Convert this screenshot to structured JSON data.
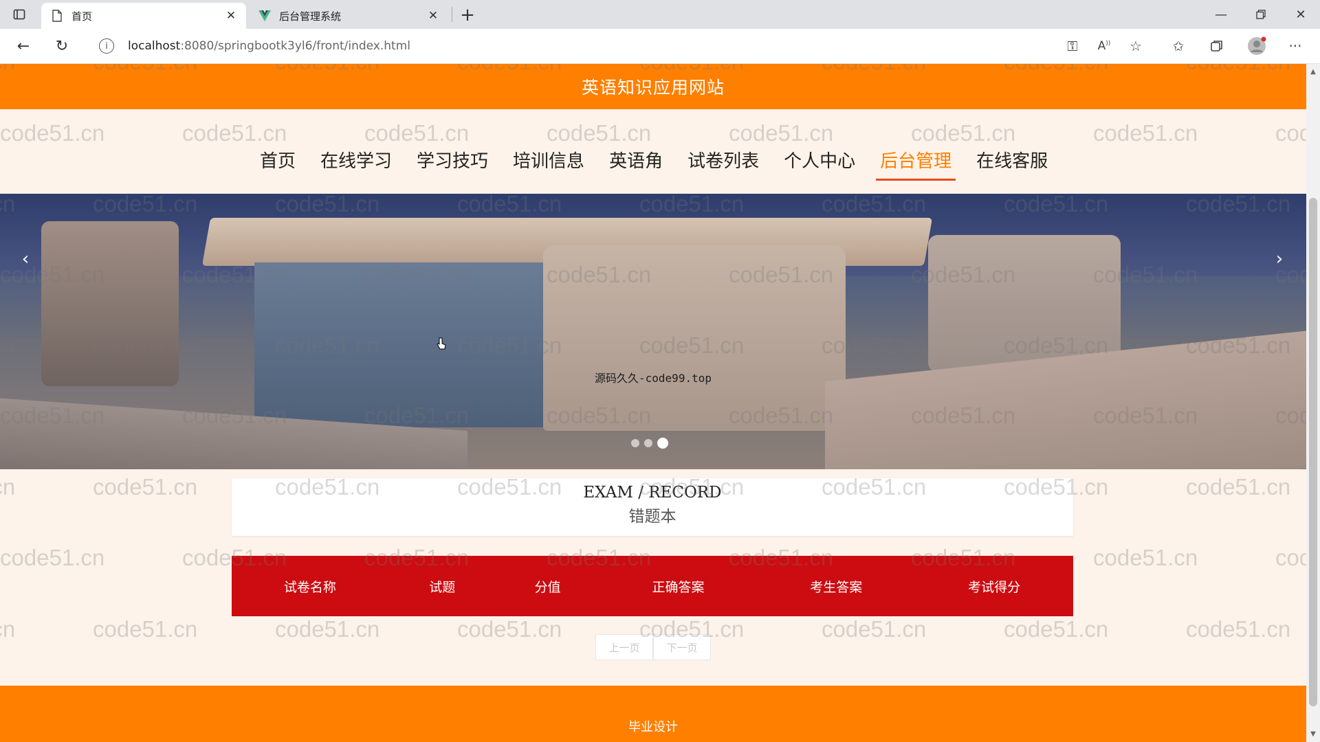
{
  "browser": {
    "tabs": [
      {
        "title": "首页",
        "active": true
      },
      {
        "title": "后台管理系统",
        "active": false
      }
    ],
    "address": {
      "host": "localhost",
      "path": ":8080/springbootk3yl6/front/index.html"
    }
  },
  "site": {
    "title": "英语知识应用网站",
    "nav": [
      {
        "label": "首页",
        "active": false
      },
      {
        "label": "在线学习",
        "active": false
      },
      {
        "label": "学习技巧",
        "active": false
      },
      {
        "label": "培训信息",
        "active": false
      },
      {
        "label": "英语角",
        "active": false
      },
      {
        "label": "试卷列表",
        "active": false
      },
      {
        "label": "个人中心",
        "active": false
      },
      {
        "label": "后台管理",
        "active": true
      },
      {
        "label": "在线客服",
        "active": false
      }
    ],
    "accent_color": "#ff7f00",
    "table_header_color": "#cc0c11"
  },
  "banner": {
    "caption": "源码久久-code99.top",
    "slides": 3,
    "active_slide": 3
  },
  "section": {
    "title_en": "EXAM / RECORD",
    "title_cn": "错题本"
  },
  "table": {
    "columns": [
      "试卷名称",
      "试题",
      "分值",
      "正确答案",
      "考生答案",
      "考试得分"
    ]
  },
  "pager": {
    "prev": "上一页",
    "next": "下一页"
  },
  "footer": {
    "text": "毕业设计"
  },
  "watermark": {
    "text": "code51.cn"
  }
}
